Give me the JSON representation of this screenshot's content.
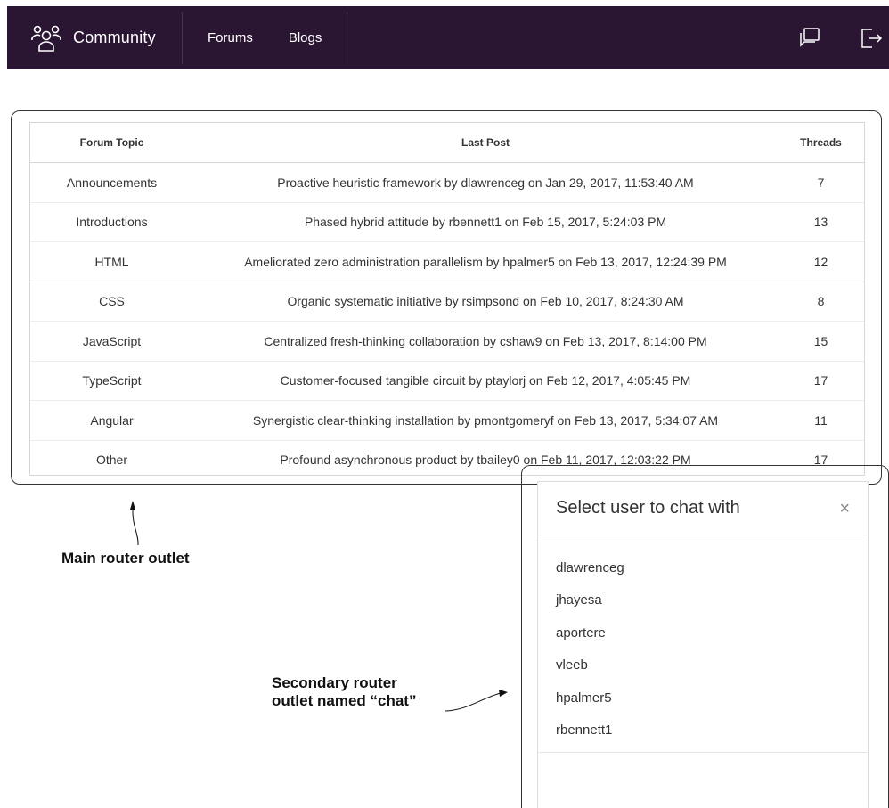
{
  "navbar": {
    "brand": "Community",
    "links": [
      "Forums",
      "Blogs"
    ]
  },
  "forums_table": {
    "headers": [
      "Forum Topic",
      "Last Post",
      "Threads"
    ],
    "rows": [
      {
        "topic": "Announcements",
        "last_post": "Proactive heuristic framework by dlawrenceg on Jan 29, 2017, 11:53:40 AM",
        "threads": "7"
      },
      {
        "topic": "Introductions",
        "last_post": "Phased hybrid attitude by rbennett1 on Feb 15, 2017, 5:24:03 PM",
        "threads": "13"
      },
      {
        "topic": "HTML",
        "last_post": "Ameliorated zero administration parallelism by hpalmer5 on Feb 13, 2017, 12:24:39 PM",
        "threads": "12"
      },
      {
        "topic": "CSS",
        "last_post": "Organic systematic initiative by rsimpsond on Feb 10, 2017, 8:24:30 AM",
        "threads": "8"
      },
      {
        "topic": "JavaScript",
        "last_post": "Centralized fresh-thinking collaboration by cshaw9 on Feb 13, 2017, 8:14:00 PM",
        "threads": "15"
      },
      {
        "topic": "TypeScript",
        "last_post": "Customer-focused tangible circuit by ptaylorj on Feb 12, 2017, 4:05:45 PM",
        "threads": "17"
      },
      {
        "topic": "Angular",
        "last_post": "Synergistic clear-thinking installation by pmontgomeryf on Feb 13, 2017, 5:34:07 AM",
        "threads": "11"
      },
      {
        "topic": "Other",
        "last_post": "Profound asynchronous product by tbailey0 on Feb 11, 2017, 12:03:22 PM",
        "threads": "17"
      }
    ]
  },
  "chat": {
    "title": "Select user to chat with",
    "close": "×",
    "users": [
      "dlawrenceg",
      "jhayesa",
      "aportere",
      "vleeb",
      "hpalmer5",
      "rbennett1"
    ]
  },
  "annotations": {
    "main": "Main router outlet",
    "secondary_line1": "Secondary router",
    "secondary_line2": "outlet named “chat”"
  }
}
